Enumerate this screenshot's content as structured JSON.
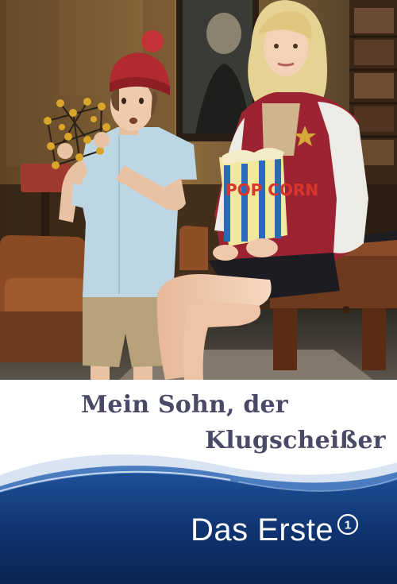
{
  "poster": {
    "title_line_1": "Mein Sohn, der",
    "title_line_2": "Klugscheißer",
    "broadcaster": "Das Erste",
    "broadcaster_logo": "1"
  },
  "photo": {
    "popcorn_bag_text": "POP CORN",
    "colors": {
      "wall": "#8a6a3c",
      "hat": "#b02a30",
      "shirt": "#bcd6e4",
      "shorts": "#b8a27a",
      "jacket_red": "#9c2432",
      "jacket_white": "#ecebe6",
      "skirt": "#1c1c22",
      "desk": "#7a4226",
      "sofa": "#8a4a24"
    }
  },
  "colors": {
    "title": "#4a4a66",
    "band_dark": "#0c2a5e",
    "band_mid": "#1e4f96",
    "band_light": "#d8e4f2",
    "brand_text": "#ffffff"
  }
}
